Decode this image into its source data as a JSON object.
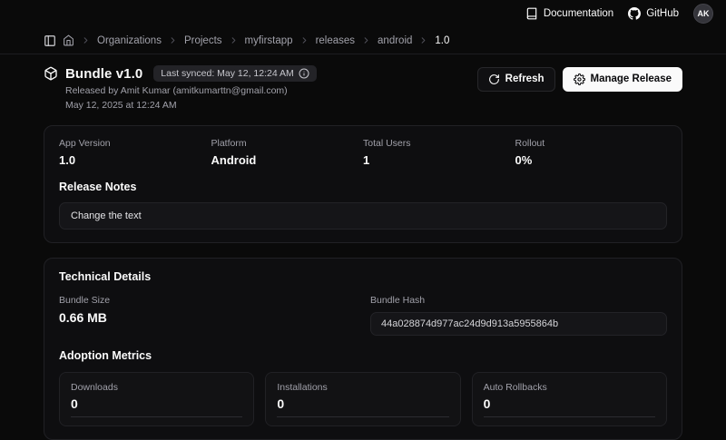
{
  "theme": {
    "background": "#0a0a0a",
    "card_background": "#0e0e10",
    "border": "#212125",
    "muted_text": "#a1a1aa",
    "accent_button": "#fafafa"
  },
  "header": {
    "documentation_label": "Documentation",
    "github_label": "GitHub",
    "avatar_initials": "AK"
  },
  "breadcrumb": {
    "items": [
      "Organizations",
      "Projects",
      "myfirstapp",
      "releases",
      "android",
      "1.0"
    ]
  },
  "release": {
    "title": "Bundle v1.0",
    "last_synced": "Last synced: May 12, 12:24 AM",
    "released_by": "Released by Amit Kumar (amitkumarttn@gmail.com)",
    "released_at": "May 12, 2025 at 12:24 AM",
    "refresh_label": "Refresh",
    "manage_label": "Manage Release"
  },
  "overview": {
    "stats": [
      {
        "label": "App Version",
        "value": "1.0"
      },
      {
        "label": "Platform",
        "value": "Android"
      },
      {
        "label": "Total Users",
        "value": "1"
      },
      {
        "label": "Rollout",
        "value": "0%"
      }
    ],
    "release_notes_label": "Release Notes",
    "release_notes_text": "Change the text"
  },
  "technical": {
    "title": "Technical Details",
    "bundle_size_label": "Bundle Size",
    "bundle_size_value": "0.66 MB",
    "bundle_hash_label": "Bundle Hash",
    "bundle_hash_value": "44a028874d977ac24d9d913a5955864b",
    "adoption_title": "Adoption Metrics",
    "metrics": [
      {
        "label": "Downloads",
        "value": "0"
      },
      {
        "label": "Installations",
        "value": "0"
      },
      {
        "label": "Auto Rollbacks",
        "value": "0"
      }
    ]
  }
}
